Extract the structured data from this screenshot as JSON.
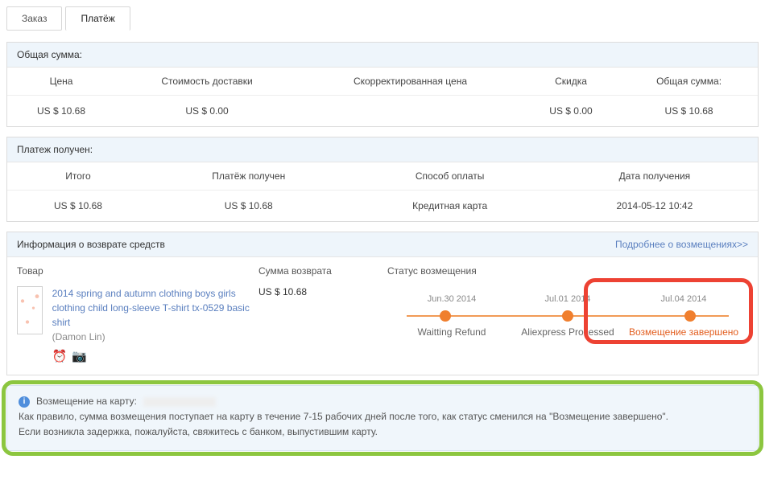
{
  "tabs": {
    "order": "Заказ",
    "payment": "Платёж"
  },
  "total": {
    "title": "Общая сумма:",
    "headers": {
      "price": "Цена",
      "ship": "Стоимость доставки",
      "adj": "Скорректированная цена",
      "discount": "Скидка",
      "sum": "Общая сумма:"
    },
    "values": {
      "price": "US $ 10.68",
      "ship": "US $ 0.00",
      "adj": "",
      "discount": "US $ 0.00",
      "sum": "US $ 10.68"
    }
  },
  "received": {
    "title": "Платеж получен:",
    "headers": {
      "subtotal": "Итого",
      "paid": "Платёж получен",
      "method": "Способ оплаты",
      "date": "Дата получения"
    },
    "values": {
      "subtotal": "US $ 10.68",
      "paid": "US $ 10.68",
      "method": "Кредитная карта",
      "date": "2014-05-12 10:42"
    }
  },
  "refund": {
    "title": "Информация о возврате средств",
    "more": "Подробнее о возмещениях>>",
    "cols": {
      "product": "Товар",
      "amount": "Сумма возврата",
      "status": "Статус возмещения"
    },
    "product": {
      "name": "2014 spring and autumn clothing boys girls clothing child long-sleeve T-shirt tx-0529 basic shirt",
      "seller": "(Damon Lin)"
    },
    "amount": "US $ 10.68",
    "timeline": {
      "dates": {
        "d1": "Jun.30 2014",
        "d2": "Jul.01 2014",
        "d3": "Jul.04 2014"
      },
      "labels": {
        "l1": "Waitting Refund",
        "l2": "Aliexpress Processed",
        "l3": "Возмещение завершено"
      }
    }
  },
  "notice": {
    "line1_prefix": "Возмещение на карту:",
    "line2": "Как правило, сумма возмещения поступает на карту в течение 7-15 рабочих дней после того, как статус сменился на \"Возмещение завершено\".",
    "line3": "Если возникла задержка, пожалуйста, свяжитесь с банком, выпустившим карту."
  }
}
